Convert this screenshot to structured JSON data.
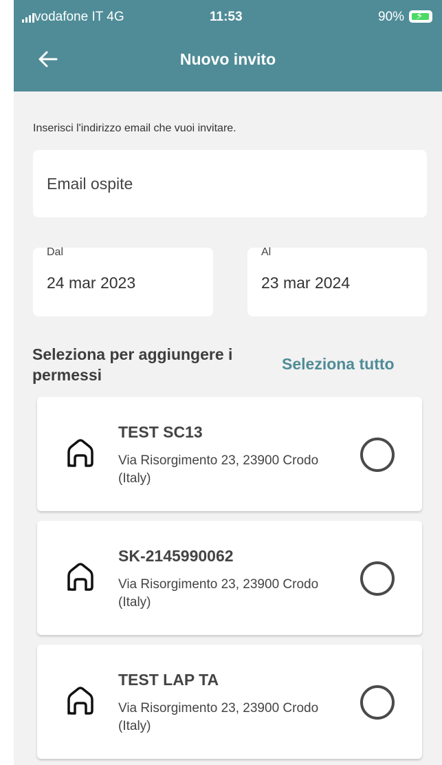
{
  "status_bar": {
    "carrier": "vodafone IT  4G",
    "time": "11:53",
    "battery": "90%"
  },
  "header": {
    "title": "Nuovo invito",
    "back_icon": "arrow-left-icon"
  },
  "form": {
    "instruction": "Inserisci l'indirizzo email che vuoi invitare.",
    "email_placeholder": "Email ospite",
    "email_value": "",
    "from_label": "Dal",
    "from_value": "24 mar 2023",
    "to_label": "Al",
    "to_value": "23 mar 2024"
  },
  "permissions": {
    "title": "Seleziona per aggiungere i permessi",
    "select_all": "Seleziona tutto",
    "items": [
      {
        "name": "TEST SC13",
        "address": "Via Risorgimento 23, 23900 Crodo (Italy)",
        "icon": "house-icon",
        "selected": false
      },
      {
        "name": "SK-2145990062",
        "address": "Via Risorgimento 23, 23900 Crodo (Italy)",
        "icon": "house-icon",
        "selected": false
      },
      {
        "name": "TEST LAP TA",
        "address": "Via Risorgimento 23, 23900 Crodo (Italy)",
        "icon": "house-icon",
        "selected": false
      }
    ]
  },
  "colors": {
    "header_bg": "#4f8c97",
    "accent": "#4f8c97",
    "page_bg": "#f2f2f2",
    "battery_fill": "#4cd964"
  }
}
